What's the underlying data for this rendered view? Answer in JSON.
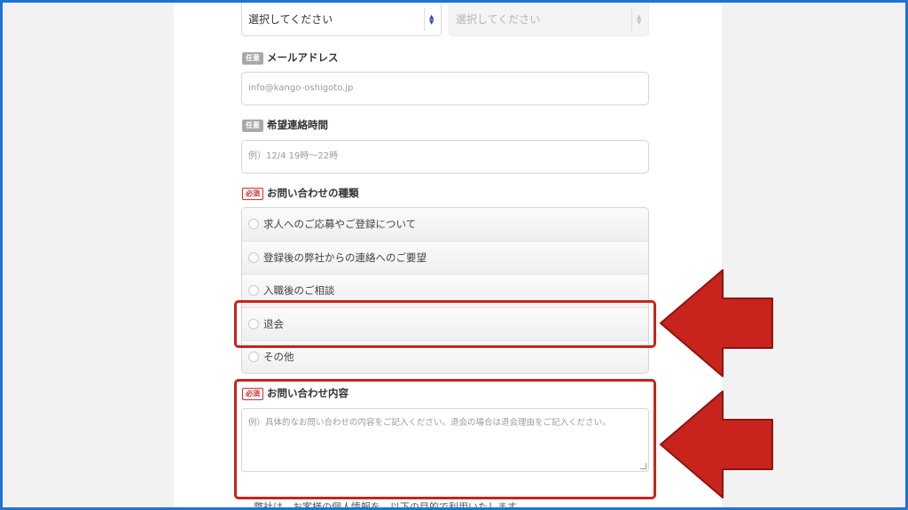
{
  "selects": {
    "first": {
      "value": "選択してください"
    },
    "second": {
      "value": "選択してください"
    }
  },
  "email": {
    "badge": "任意",
    "label": "メールアドレス",
    "placeholder": "info@kango-oshigoto.jp"
  },
  "contact_time": {
    "badge": "任意",
    "label": "希望連絡時間",
    "placeholder": "例）12/4 19時〜22時"
  },
  "inquiry_type": {
    "badge": "必須",
    "label": "お問い合わせの種類",
    "options": [
      "求人へのご応募やご登録について",
      "登録後の弊社からの連絡へのご要望",
      "入職後のご相談",
      "退会",
      "その他"
    ]
  },
  "inquiry_content": {
    "badge": "必須",
    "label": "お問い合わせ内容",
    "placeholder": "例）具体的なお問い合わせの内容をご記入ください。退会の場合は退会理由をご記入ください。"
  },
  "footer_note": "弊社は、お客様の個人情報を、以下の目的で利用いたします。",
  "colors": {
    "highlight": "#c8231c",
    "frame": "#1f73d6",
    "required_badge": "#cf2f2f",
    "optional_badge": "#a8a8a8"
  }
}
